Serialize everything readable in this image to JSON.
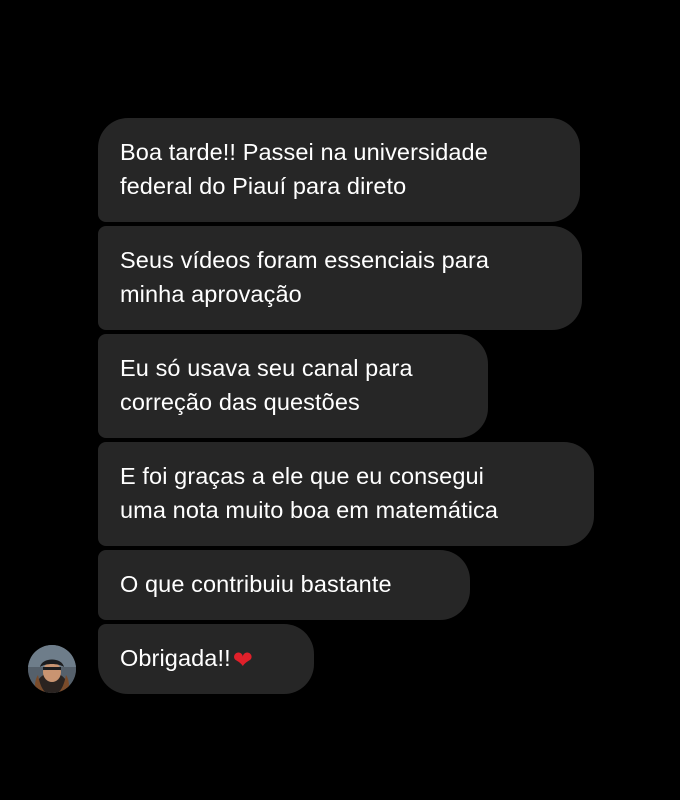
{
  "conversation": {
    "messages": [
      {
        "line1": "Boa tarde!! Passei na universidade",
        "line2": "federal do Piauí para direto"
      },
      {
        "line1": "Seus vídeos foram essenciais para",
        "line2": "minha aprovação"
      },
      {
        "line1": "Eu só usava seu canal para",
        "line2": "correção das questões"
      },
      {
        "line1": "E foi graças a ele que eu consegui",
        "line2": "uma nota muito boa em matemática"
      },
      {
        "line1": "O que contribuiu bastante"
      },
      {
        "line1": "Obrigada!!",
        "emoji": "❤"
      }
    ],
    "sender_avatar_icon": "avatar-photo",
    "heart_color": "#e0202a",
    "bubble_color": "#262626",
    "background_color": "#000000"
  }
}
